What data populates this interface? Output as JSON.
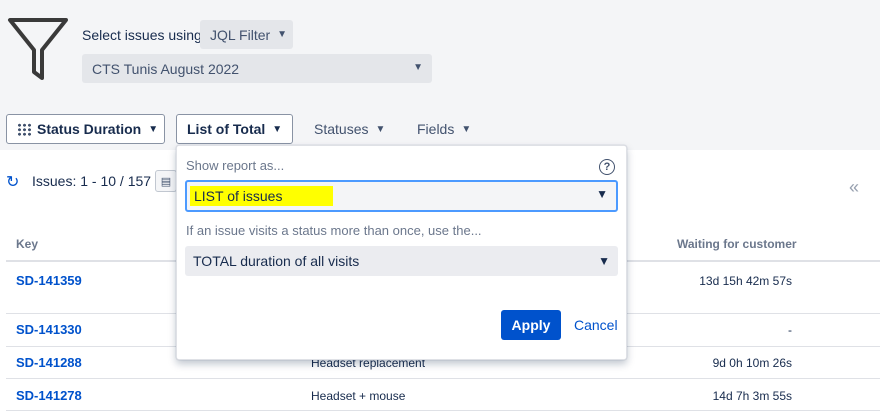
{
  "header": {
    "select_label": "Select issues using",
    "filter_type": "JQL Filter",
    "filter_name": "CTS Tunis August 2022"
  },
  "toolbar": {
    "status_duration": "Status Duration",
    "list_of_total": "List of Total",
    "statuses": "Statuses",
    "fields": "Fields"
  },
  "issues": {
    "count_label": "Issues: 1 - 10 / 157"
  },
  "table": {
    "columns": {
      "key": "Key",
      "waiting": "Waiting for customer"
    },
    "rows": [
      {
        "key": "SD-141359",
        "summary": "",
        "waiting": "13d 15h 42m 57s"
      },
      {
        "key": "SD-141330",
        "summary": "",
        "waiting": "-"
      },
      {
        "key": "SD-141288",
        "summary": "Headset replacement",
        "waiting": "9d 0h 10m 26s"
      },
      {
        "key": "SD-141278",
        "summary": "Headset + mouse",
        "waiting": "14d 7h 3m 55s"
      }
    ]
  },
  "dropdown": {
    "show_report_label": "Show report as...",
    "report_value": "LIST of issues",
    "visits_label": "If an issue visits a status more than once, use the...",
    "visits_value": "TOTAL duration of all visits",
    "apply_label": "Apply",
    "cancel_label": "Cancel"
  },
  "colors": {
    "accent": "#0052cc",
    "highlight": "#ffff00",
    "focus_border": "#4c9aff"
  },
  "icons": [
    "filter-funnel-icon",
    "chevron-down-icon",
    "grid-icon",
    "refresh-icon",
    "chart-icon",
    "help-icon",
    "double-chevron-left-icon"
  ]
}
